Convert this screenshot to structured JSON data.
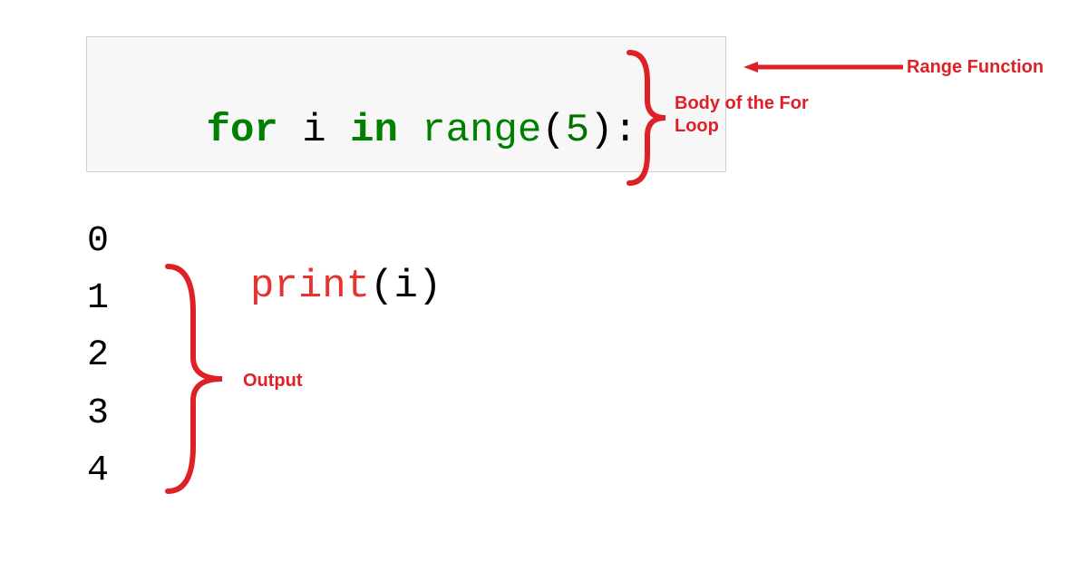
{
  "code": {
    "kw_for": "for",
    "var_i": "i",
    "kw_in": "in",
    "fn_range": "range",
    "lparen1": "(",
    "range_arg": "5",
    "rparen1": ")",
    "colon": ":",
    "fn_print": "print",
    "lparen2": "(",
    "print_arg": "i",
    "rparen2": ")"
  },
  "output": {
    "lines": [
      "0",
      "1",
      "2",
      "3",
      "4"
    ]
  },
  "labels": {
    "range_function": "Range Function",
    "body": "Body of the For Loop",
    "output": "Output"
  }
}
